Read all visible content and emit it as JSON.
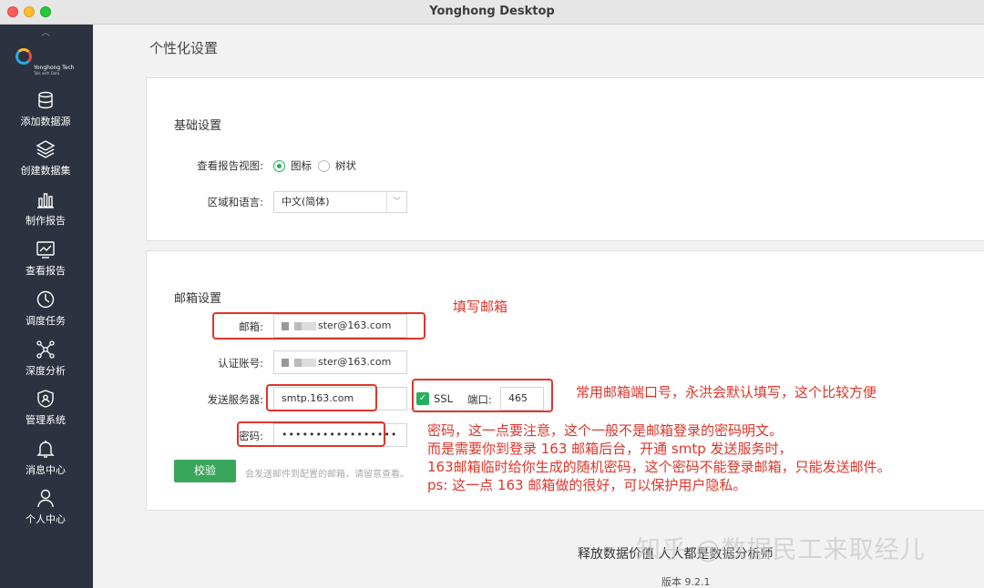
{
  "window": {
    "title": "Yonghong Desktop"
  },
  "logo": {
    "name": "Yonghong Tech",
    "tagline": "Talk with Data"
  },
  "sidebar": {
    "items": [
      {
        "label": "添加数据源",
        "icon": "database-icon"
      },
      {
        "label": "创建数据集",
        "icon": "layers-icon"
      },
      {
        "label": "制作报告",
        "icon": "bar-chart-icon"
      },
      {
        "label": "查看报告",
        "icon": "line-chart-icon"
      },
      {
        "label": "调度任务",
        "icon": "clock-icon"
      },
      {
        "label": "深度分析",
        "icon": "network-icon"
      },
      {
        "label": "管理系统",
        "icon": "shield-icon"
      },
      {
        "label": "消息中心",
        "icon": "bell-icon"
      },
      {
        "label": "个人中心",
        "icon": "user-icon"
      }
    ]
  },
  "page": {
    "title": "个性化设置"
  },
  "basic": {
    "title": "基础设置",
    "view_label": "查看报告视图:",
    "view_options": [
      "图标",
      "树状"
    ],
    "view_selected": "图标",
    "locale_label": "区域和语言:",
    "locale_value": "中文(简体)"
  },
  "mail": {
    "title": "邮箱设置",
    "email_label": "邮箱:",
    "email_value": "ster@163.com",
    "account_label": "认证账号:",
    "account_value": "ster@163.com",
    "server_label": "发送服务器:",
    "server_value": "smtp.163.com",
    "ssl_label": "SSL",
    "ssl_checked": true,
    "port_label": "端口:",
    "port_value": "465",
    "password_label": "密码:",
    "password_value": "•••••••••••••••••",
    "verify_button": "校验",
    "verify_hint": "会发送邮件到配置的邮箱，请留意查看。"
  },
  "annotations": {
    "email": "填写邮箱",
    "port": "常用邮箱端口号，永洪会默认填写，这个比较方便",
    "password_lines": [
      "密码，这一点要注意，这个一般不是邮箱登录的密码明文。",
      "而是需要你到登录 163 邮箱后台，开通 smtp 发送服务时，",
      "163邮箱临时给你生成的随机密码，这个密码不能登录邮箱，只能发送邮件。",
      "ps: 这一点 163 邮箱做的很好，可以保护用户隐私。"
    ]
  },
  "footer": {
    "slogan": "释放数据价值 人人都是数据分析师",
    "version": "版本 9.2.1"
  },
  "watermark": "知乎 @数据民工来取经儿"
}
